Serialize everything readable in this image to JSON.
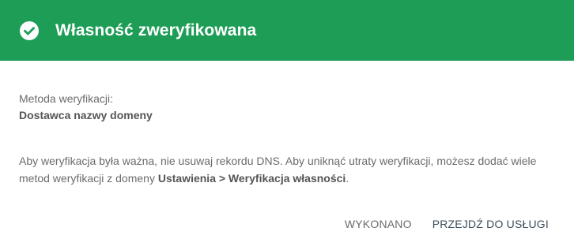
{
  "header": {
    "icon": "check-circle-icon",
    "title": "Własność zweryfikowana",
    "background": "#1e9d57"
  },
  "method": {
    "label": "Metoda weryfikacji:",
    "value": "Dostawca nazwy domeny"
  },
  "info": {
    "text_before": "Aby weryfikacja była ważna, nie usuwaj rekordu DNS. Aby uniknąć utraty weryfikacji, możesz dodać wiele metod weryfikacji z domeny ",
    "bold": "Ustawienia > Weryfikacja własności",
    "text_after": "."
  },
  "actions": {
    "done_label": "WYKONANO",
    "go_label": "PRZEJDŹ DO USŁUGI"
  }
}
